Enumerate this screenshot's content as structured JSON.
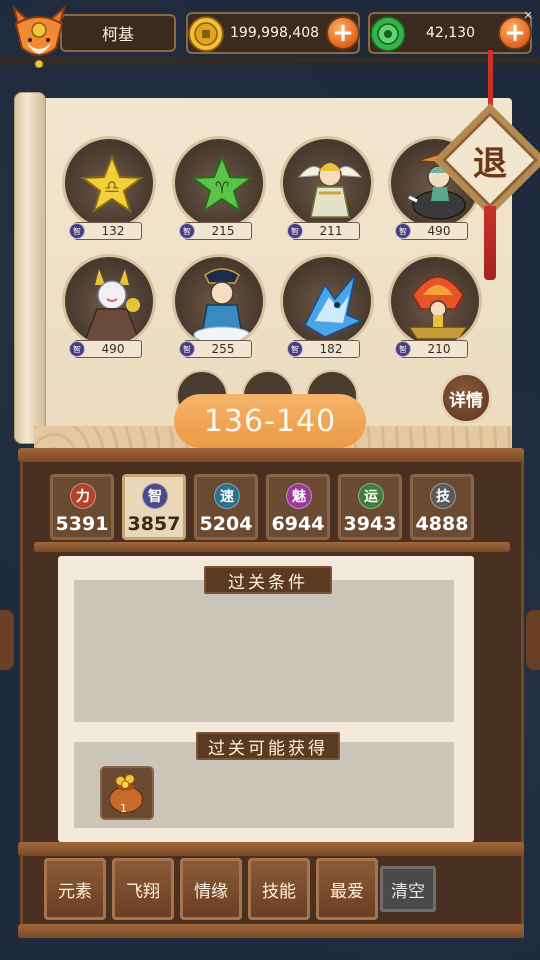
{
  "player": {
    "name": "柯基"
  },
  "currencies": {
    "coins": "199,998,408",
    "gems": "42,130"
  },
  "exit_label": "退",
  "characters": [
    {
      "stat_badge": "智",
      "value": "132",
      "kind": "libra-star"
    },
    {
      "stat_badge": "智",
      "value": "215",
      "kind": "green-star"
    },
    {
      "stat_badge": "智",
      "value": "211",
      "kind": "winged-warrior"
    },
    {
      "stat_badge": "智",
      "value": "490",
      "kind": "boar-rider"
    },
    {
      "stat_badge": "智",
      "value": "490",
      "kind": "fox-lady"
    },
    {
      "stat_badge": "智",
      "value": "255",
      "kind": "cloud-scholar"
    },
    {
      "stat_badge": "智",
      "value": "182",
      "kind": "ice-beast"
    },
    {
      "stat_badge": "智",
      "value": "210",
      "kind": "fire-boat"
    }
  ],
  "level_range": "136-140",
  "detail_button": "详情",
  "stat_tabs": [
    {
      "label": "力",
      "value": "5391",
      "color": "#b3442a",
      "active": false
    },
    {
      "label": "智",
      "value": "3857",
      "color": "#4d4a8c",
      "active": true
    },
    {
      "label": "速",
      "value": "5204",
      "color": "#2f6f8e",
      "active": false
    },
    {
      "label": "魅",
      "value": "6944",
      "color": "#9a3b9a",
      "active": false
    },
    {
      "label": "运",
      "value": "3943",
      "color": "#3f7d3a",
      "active": false
    },
    {
      "label": "技",
      "value": "4888",
      "color": "#5a5a5a",
      "active": false
    }
  ],
  "conditions_title": "过关条件",
  "rewards_title": "过关可能获得",
  "reward": {
    "count": "1",
    "icon": "gold-bag-icon"
  },
  "filter_buttons": [
    "元素",
    "飞翔",
    "情缘",
    "技能",
    "最爱"
  ],
  "clear_button": "清空"
}
